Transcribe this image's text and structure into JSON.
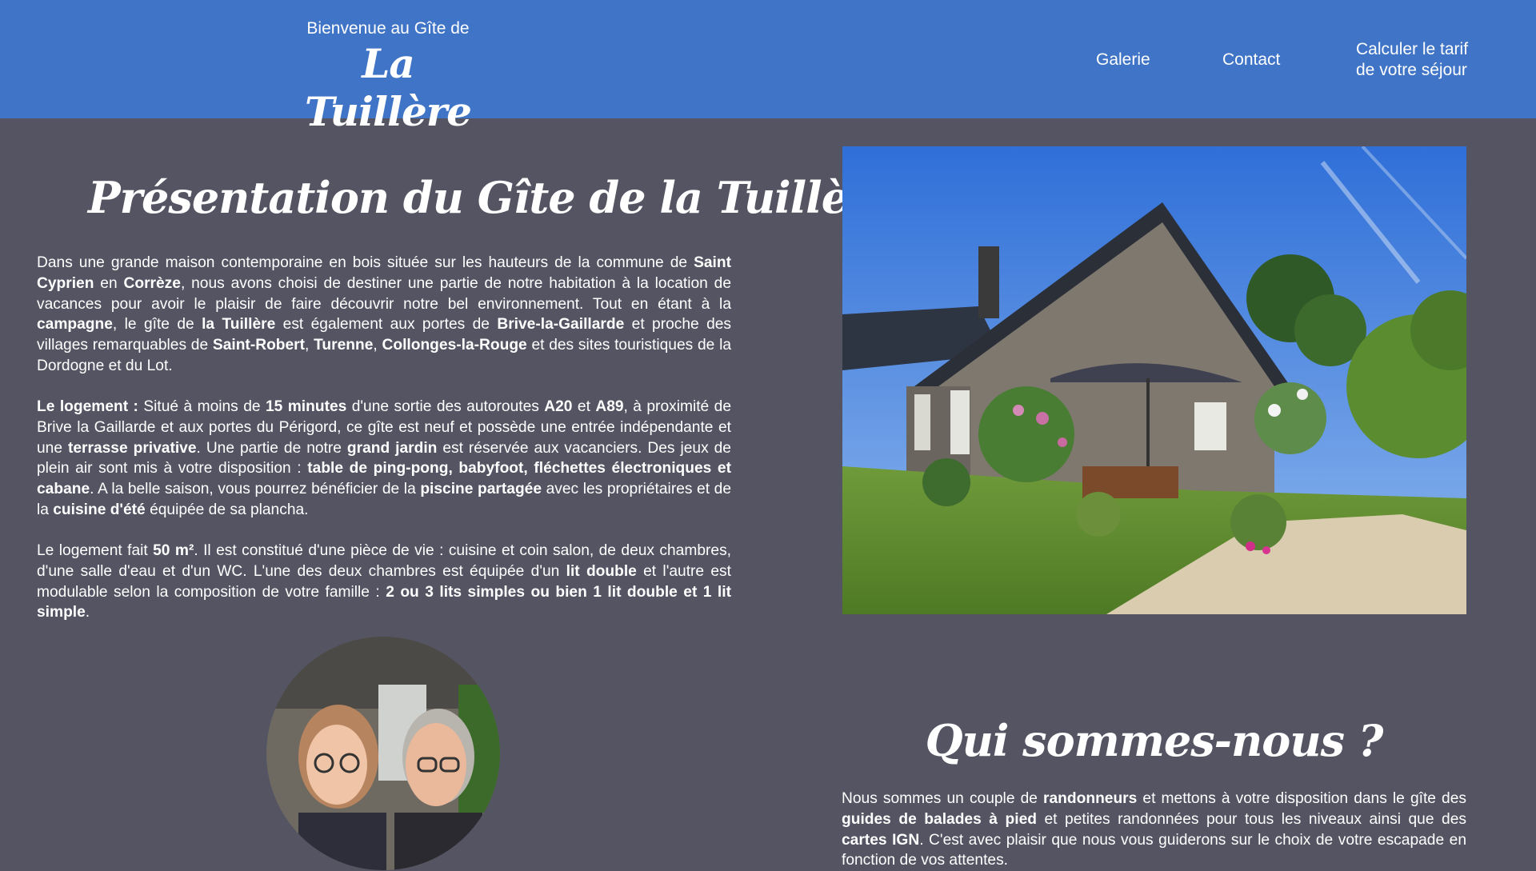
{
  "header": {
    "brand_small": "Bienvenue au Gîte de",
    "brand_big": "La Tuillère",
    "nav": {
      "galerie": "Galerie",
      "contact": "Contact",
      "calc_line1": "Calculer le tarif",
      "calc_line2": "de votre séjour"
    }
  },
  "presentation": {
    "title": "Présentation du Gîte de la Tuillère :",
    "p1": [
      {
        "t": "Dans une grande maison contemporaine en bois située sur les hauteurs de la commune de "
      },
      {
        "t": "Saint Cyprien",
        "b": true
      },
      {
        "t": " en "
      },
      {
        "t": "Corrèze",
        "b": true
      },
      {
        "t": ", nous avons choisi de destiner une partie de notre habitation à la location de vacances pour avoir le plaisir de faire découvrir notre bel environnement. Tout en étant à la "
      },
      {
        "t": "campagne",
        "b": true
      },
      {
        "t": ", le gîte de "
      },
      {
        "t": "la Tuillère",
        "b": true
      },
      {
        "t": " est également aux portes de "
      },
      {
        "t": "Brive-la-Gaillarde",
        "b": true
      },
      {
        "t": " et proche des villages remarquables de "
      },
      {
        "t": "Saint-Robert",
        "b": true
      },
      {
        "t": ", "
      },
      {
        "t": "Turenne",
        "b": true
      },
      {
        "t": ", "
      },
      {
        "t": "Collonges-la-Rouge",
        "b": true
      },
      {
        "t": " et des sites touristiques de la Dordogne et du Lot."
      }
    ],
    "p2": [
      {
        "t": "Le logement :",
        "b": true
      },
      {
        "t": " Situé à moins de "
      },
      {
        "t": "15 minutes",
        "b": true
      },
      {
        "t": " d'une sortie des autoroutes "
      },
      {
        "t": "A20",
        "b": true
      },
      {
        "t": " et "
      },
      {
        "t": "A89",
        "b": true
      },
      {
        "t": ", à proximité de Brive la Gaillarde et aux portes du Périgord, ce gîte est neuf et possède une entrée indépendante et une "
      },
      {
        "t": "terrasse privative",
        "b": true
      },
      {
        "t": ". Une partie de notre "
      },
      {
        "t": "grand jardin",
        "b": true
      },
      {
        "t": " est réservée aux vacanciers. Des jeux de plein air sont mis à votre disposition : "
      },
      {
        "t": "table de ping-pong, babyfoot, fléchettes électroniques et cabane",
        "b": true
      },
      {
        "t": ". A la belle saison, vous pourrez bénéficier de la "
      },
      {
        "t": "piscine partagée",
        "b": true
      },
      {
        "t": " avec les propriétaires et de la "
      },
      {
        "t": "cuisine d'été",
        "b": true
      },
      {
        "t": " équipée de sa plancha."
      }
    ],
    "p3": [
      {
        "t": "Le logement fait "
      },
      {
        "t": "50 m²",
        "b": true
      },
      {
        "t": ". Il est constitué d'une pièce de vie : cuisine et coin salon, de deux chambres, d'une salle d'eau et d'un WC. L'une des deux chambres est équipée d'un "
      },
      {
        "t": "lit double",
        "b": true
      },
      {
        "t": " et l'autre est modulable selon la composition de votre famille : "
      },
      {
        "t": "2 ou 3 lits simples ou bien 1 lit double et 1 lit simple",
        "b": true
      },
      {
        "t": "."
      }
    ]
  },
  "about": {
    "title": "Qui sommes-nous ?",
    "p1": [
      {
        "t": "Nous sommes un couple de "
      },
      {
        "t": "randonneurs",
        "b": true
      },
      {
        "t": " et mettons à votre disposition dans le gîte des "
      },
      {
        "t": "guides de balades à pied",
        "b": true
      },
      {
        "t": " et petites randonnées pour tous les niveaux ainsi que des "
      },
      {
        "t": "cartes IGN",
        "b": true
      },
      {
        "t": ". C'est avec plaisir que nous vous guiderons sur le choix de votre escapade en fonction de vos attentes."
      }
    ]
  },
  "colors": {
    "header_bg": "#3f74c7",
    "page_bg": "#545463",
    "text": "#ffffff"
  }
}
